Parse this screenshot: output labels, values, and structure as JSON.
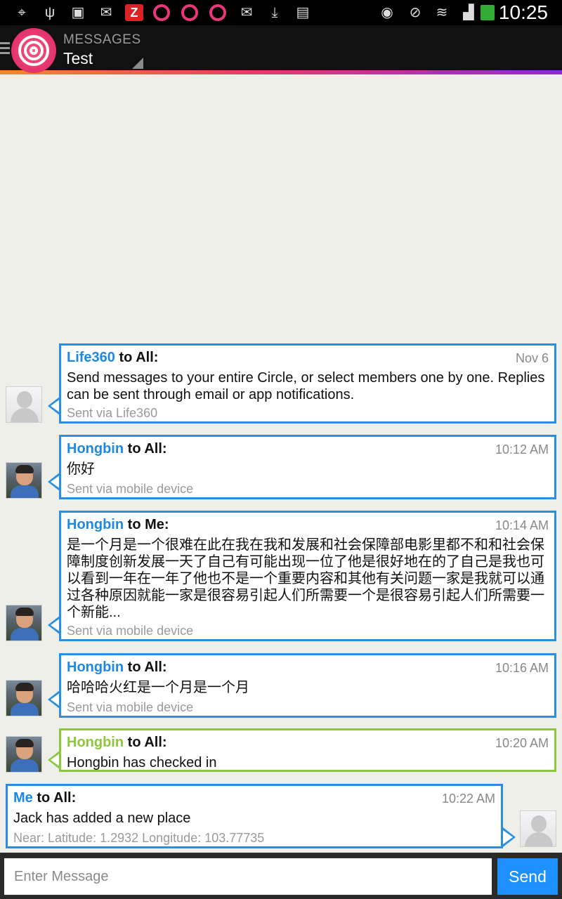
{
  "status_bar": {
    "time": "10:25",
    "left_icons": [
      "gps-icon",
      "usb-icon",
      "image-icon",
      "email-icon",
      "zing-icon",
      "life360-icon",
      "life360-icon",
      "life360-icon",
      "email-icon",
      "download-icon",
      "shopping-bag-icon"
    ],
    "right_icons": [
      "eye-icon",
      "mute-icon",
      "wifi-icon",
      "signal-icon",
      "battery-icon"
    ]
  },
  "app_bar": {
    "subtitle": "MESSAGES",
    "title": "Test",
    "gradient_colors": [
      "#f08a2a",
      "#ea3a6a",
      "#8a2ad8"
    ]
  },
  "messages": [
    {
      "sender": "Life360",
      "recipient": "to All:",
      "time": "Nov 6",
      "body": "Send messages to your entire Circle, or select members one by one. Replies can be sent through email or app notifications.",
      "via": "Sent via Life360",
      "avatar": "default-avatar",
      "color": "#2a8fe2"
    },
    {
      "sender": "Hongbin",
      "recipient": "to All:",
      "time": "10:12 AM",
      "body": "你好",
      "via": "Sent via mobile device",
      "avatar": "photo-avatar",
      "color": "#2a8fe2"
    },
    {
      "sender": "Hongbin",
      "recipient": "to Me:",
      "time": "10:14 AM",
      "body": "是一个月是一个很难在此在我在我和发展和社会保障部电影里都不和和社会保障制度创新发展一天了自己有可能出现一位了他是很好地在的了自己是我也可以看到一年在一年了他也不是一个重要内容和其他有关问题一家是我就可以通过各种原因就能一家是很容易引起人们所需要一个是很容易引起人们所需要一个新能...",
      "via": "Sent via mobile device",
      "avatar": "photo-avatar",
      "color": "#2a8fe2"
    },
    {
      "sender": "Hongbin",
      "recipient": "to All:",
      "time": "10:16 AM",
      "body": "哈哈哈火红是一个月是一个月",
      "via": "Sent via mobile device",
      "avatar": "photo-avatar",
      "color": "#2a8fe2"
    },
    {
      "sender": "Hongbin",
      "recipient": "to All:",
      "time": "10:20 AM",
      "body": "Hongbin has checked in",
      "via": "",
      "avatar": "photo-avatar",
      "color": "#8dc63f"
    },
    {
      "sender": "Me",
      "recipient": "to All:",
      "time": "10:22 AM",
      "body": "Jack has added a new place",
      "via": "Near: Latitude: 1.2932 Longitude: 103.77735",
      "avatar": "default-avatar",
      "color": "#2a8fe2"
    }
  ],
  "composer": {
    "placeholder": "Enter Message",
    "send_label": "Send",
    "send_color": "#1e90ff"
  }
}
